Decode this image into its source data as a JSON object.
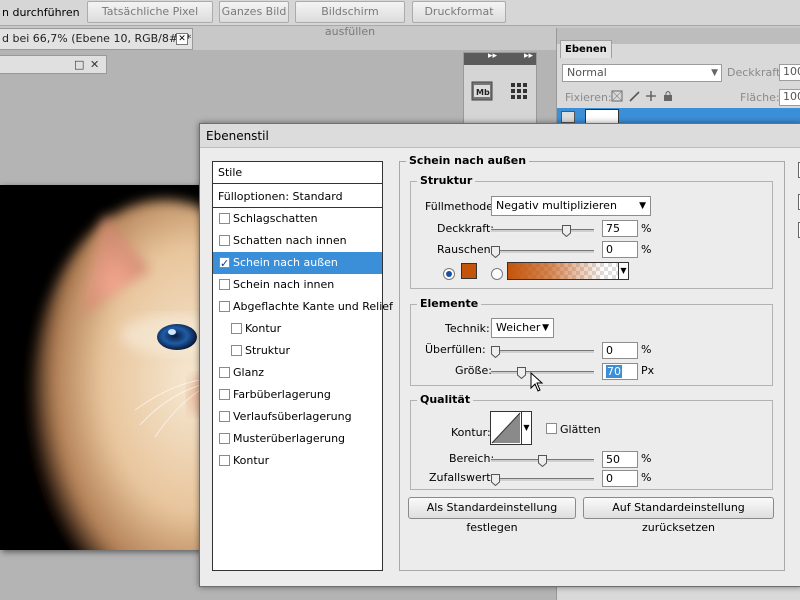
{
  "topbar": {
    "first_label": "n durchführen",
    "buttons": [
      "Tatsächliche Pixel",
      "Ganzes Bild",
      "Bildschirm ausfüllen",
      "Druckformat"
    ]
  },
  "document": {
    "tab_title": "d bei 66,7% (Ebene 10, RGB/8#) *",
    "close_glyph": "✕",
    "subwindow_glyphs": [
      "□",
      "✕"
    ]
  },
  "layers_panel": {
    "tab_label": "Ebenen",
    "blend_mode": "Normal",
    "opacity_label": "Deckkraft:",
    "opacity_value": "100",
    "lock_label": "Fixieren:",
    "fill_label": "Fläche:",
    "fill_value": "100"
  },
  "dialog": {
    "title": "Ebenenstil",
    "styles_header": "Stile",
    "styles": [
      {
        "label": "Fülloptionen: Standard",
        "checkbox": false,
        "checked": false,
        "indent": 0
      },
      {
        "label": "Schlagschatten",
        "checkbox": true,
        "checked": false,
        "indent": 0
      },
      {
        "label": "Schatten nach innen",
        "checkbox": true,
        "checked": false,
        "indent": 0
      },
      {
        "label": "Schein nach außen",
        "checkbox": true,
        "checked": true,
        "indent": 0,
        "selected": true
      },
      {
        "label": "Schein nach innen",
        "checkbox": true,
        "checked": false,
        "indent": 0
      },
      {
        "label": "Abgeflachte Kante und Relief",
        "checkbox": true,
        "checked": false,
        "indent": 0
      },
      {
        "label": "Kontur",
        "checkbox": true,
        "checked": false,
        "indent": 1
      },
      {
        "label": "Struktur",
        "checkbox": true,
        "checked": false,
        "indent": 1
      },
      {
        "label": "Glanz",
        "checkbox": true,
        "checked": false,
        "indent": 0
      },
      {
        "label": "Farbüberlagerung",
        "checkbox": true,
        "checked": false,
        "indent": 0
      },
      {
        "label": "Verlaufsüberlagerung",
        "checkbox": true,
        "checked": false,
        "indent": 0
      },
      {
        "label": "Musterüberlagerung",
        "checkbox": true,
        "checked": false,
        "indent": 0
      },
      {
        "label": "Kontur",
        "checkbox": true,
        "checked": false,
        "indent": 0
      }
    ],
    "section_title": "Schein nach außen",
    "struktur": {
      "title": "Struktur",
      "blend_label": "Füllmethode:",
      "blend_value": "Negativ multiplizieren",
      "opacity_label": "Deckkraft:",
      "opacity_value": "75",
      "opacity_fraction": 0.75,
      "noise_label": "Rauschen:",
      "noise_value": "0",
      "noise_fraction": 0,
      "percent": "%",
      "color": "#c4540c"
    },
    "elemente": {
      "title": "Elemente",
      "technique_label": "Technik:",
      "technique_value": "Weicher",
      "spread_label": "Überfüllen:",
      "spread_value": "0",
      "spread_fraction": 0,
      "size_label": "Größe:",
      "size_value": "70",
      "size_fraction": 0.28,
      "percent": "%",
      "px": "Px"
    },
    "qualitaet": {
      "title": "Qualität",
      "contour_label": "Kontur:",
      "antialias_label": "Glätten",
      "range_label": "Bereich:",
      "range_value": "50",
      "range_fraction": 0.5,
      "jitter_label": "Zufallswert:",
      "jitter_value": "0",
      "jitter_fraction": 0,
      "percent": "%"
    },
    "buttons": {
      "make_default": "Als Standardeinstellung festlegen",
      "reset_default": "Auf Standardeinstellung zurücksetzen"
    }
  },
  "colors": {
    "selection": "#3b8fd8",
    "glow_color": "#c4540c"
  }
}
